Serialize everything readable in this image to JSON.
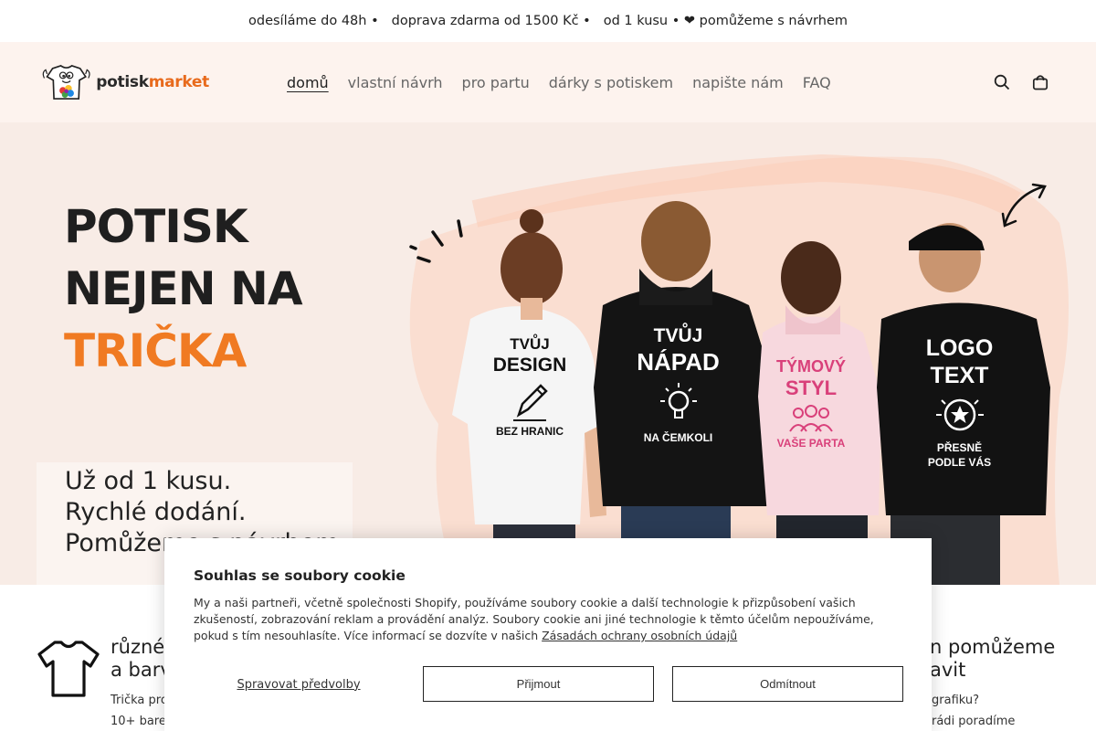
{
  "announcement": {
    "items": [
      "odesíláme do 48h •",
      "doprava zdarma od 1500 Kč •",
      "od 1 kusu • ❤ pomůžeme s návrhem"
    ]
  },
  "header": {
    "logo": {
      "part1": "potisk",
      "part2": "market"
    },
    "nav": [
      {
        "label": "domů",
        "active": true
      },
      {
        "label": "vlastní návrh",
        "active": false
      },
      {
        "label": "pro partu",
        "active": false
      },
      {
        "label": "dárky s potiskem",
        "active": false
      },
      {
        "label": "napište nám",
        "active": false
      },
      {
        "label": "FAQ",
        "active": false
      }
    ],
    "icons": [
      "search-icon",
      "cart-icon"
    ]
  },
  "hero": {
    "title_line1": "POTISK",
    "title_line2": "NEJEN NA",
    "title_line3": "TRIČKA",
    "subtitle_line1": "Už od 1 kusu.",
    "subtitle_line2": "Rychlé dodání.",
    "subtitle_line3": "Pomůžeme s návrhem.",
    "shirts": [
      {
        "top": "TVŮJ",
        "main": "DESIGN",
        "bottom": "BEZ HRANIC",
        "icon": "pencil-icon",
        "garment": "white-tshirt"
      },
      {
        "top": "TVŮJ",
        "main": "NÁPAD",
        "bottom": "NA ČEMKOLI",
        "icon": "lightbulb-icon",
        "garment": "black-hoodie"
      },
      {
        "top": "TÝMOVÝ",
        "main": "STYL",
        "bottom": "VAŠE PARTA",
        "icon": "group-icon",
        "garment": "pink-hoodie"
      },
      {
        "top": "LOGO",
        "main": "TEXT",
        "bottom": "PŘESNĚ PODLE VÁS",
        "icon": "star-icon",
        "garment": "black-hoodie"
      }
    ],
    "colors": {
      "accent": "#f07a22",
      "bg": "#f8ece6",
      "pink_text": "#d9407a"
    }
  },
  "benefits": {
    "left": {
      "title_line1": "různé",
      "title_line2": "a barv",
      "text_line1": "Trička pro",
      "text_line2": "10+ barev"
    },
    "right": {
      "title_line1": "n pomůžeme",
      "title_line2": "avit",
      "text_line1": "grafiku?",
      "text_line2": "rádi poradíme"
    }
  },
  "cookie": {
    "title": "Souhlas se soubory cookie",
    "text": "My a naši partneři, včetně společnosti Shopify, používáme soubory cookie a další technologie k přizpůsobení vašich zkušeností, zobrazování reklam a provádění analýz. Soubory cookie ani jiné technologie k těmto účelům nepoužíváme, pokud s tím nesouhlasíte. Více informací se dozvíte v našich",
    "link": "Zásadách ochrany osobních údajů",
    "manage": "Spravovat předvolby",
    "accept": "Přijmout",
    "decline": "Odmítnout"
  }
}
